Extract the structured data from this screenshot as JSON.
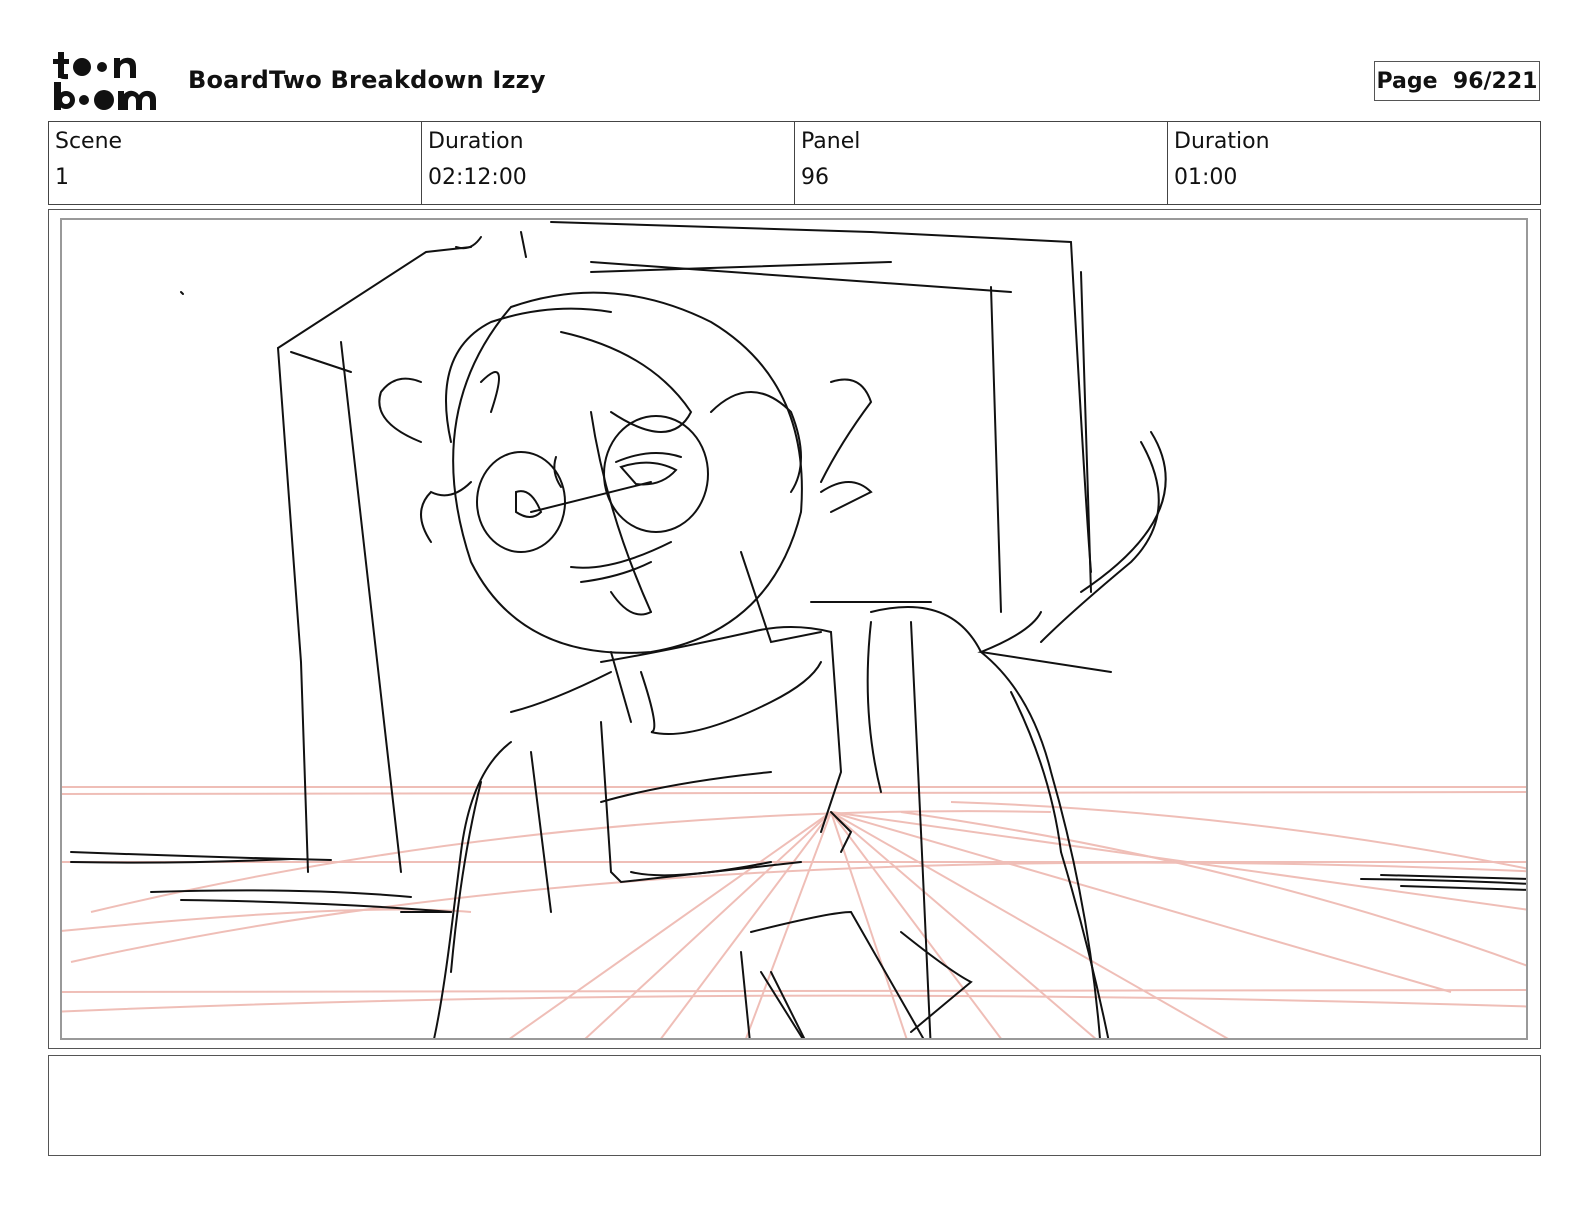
{
  "header": {
    "logo_text": "toon boom",
    "title": "BoardTwo Breakdown Izzy",
    "page_label": "Page",
    "page_value": "96/221"
  },
  "info": [
    {
      "label": "Scene",
      "value": "1"
    },
    {
      "label": "Duration",
      "value": "02:12:00"
    },
    {
      "label": "Panel",
      "value": "96"
    },
    {
      "label": "Duration",
      "value": "01:00"
    }
  ],
  "panel": {
    "sketch_subject": "rough pencil sketch of smiling character with curly hair and glasses leaning by a pillow, red perspective lines",
    "line_color": "#111111",
    "guide_color": "#eeb8b0"
  },
  "notes": {
    "text": ""
  }
}
